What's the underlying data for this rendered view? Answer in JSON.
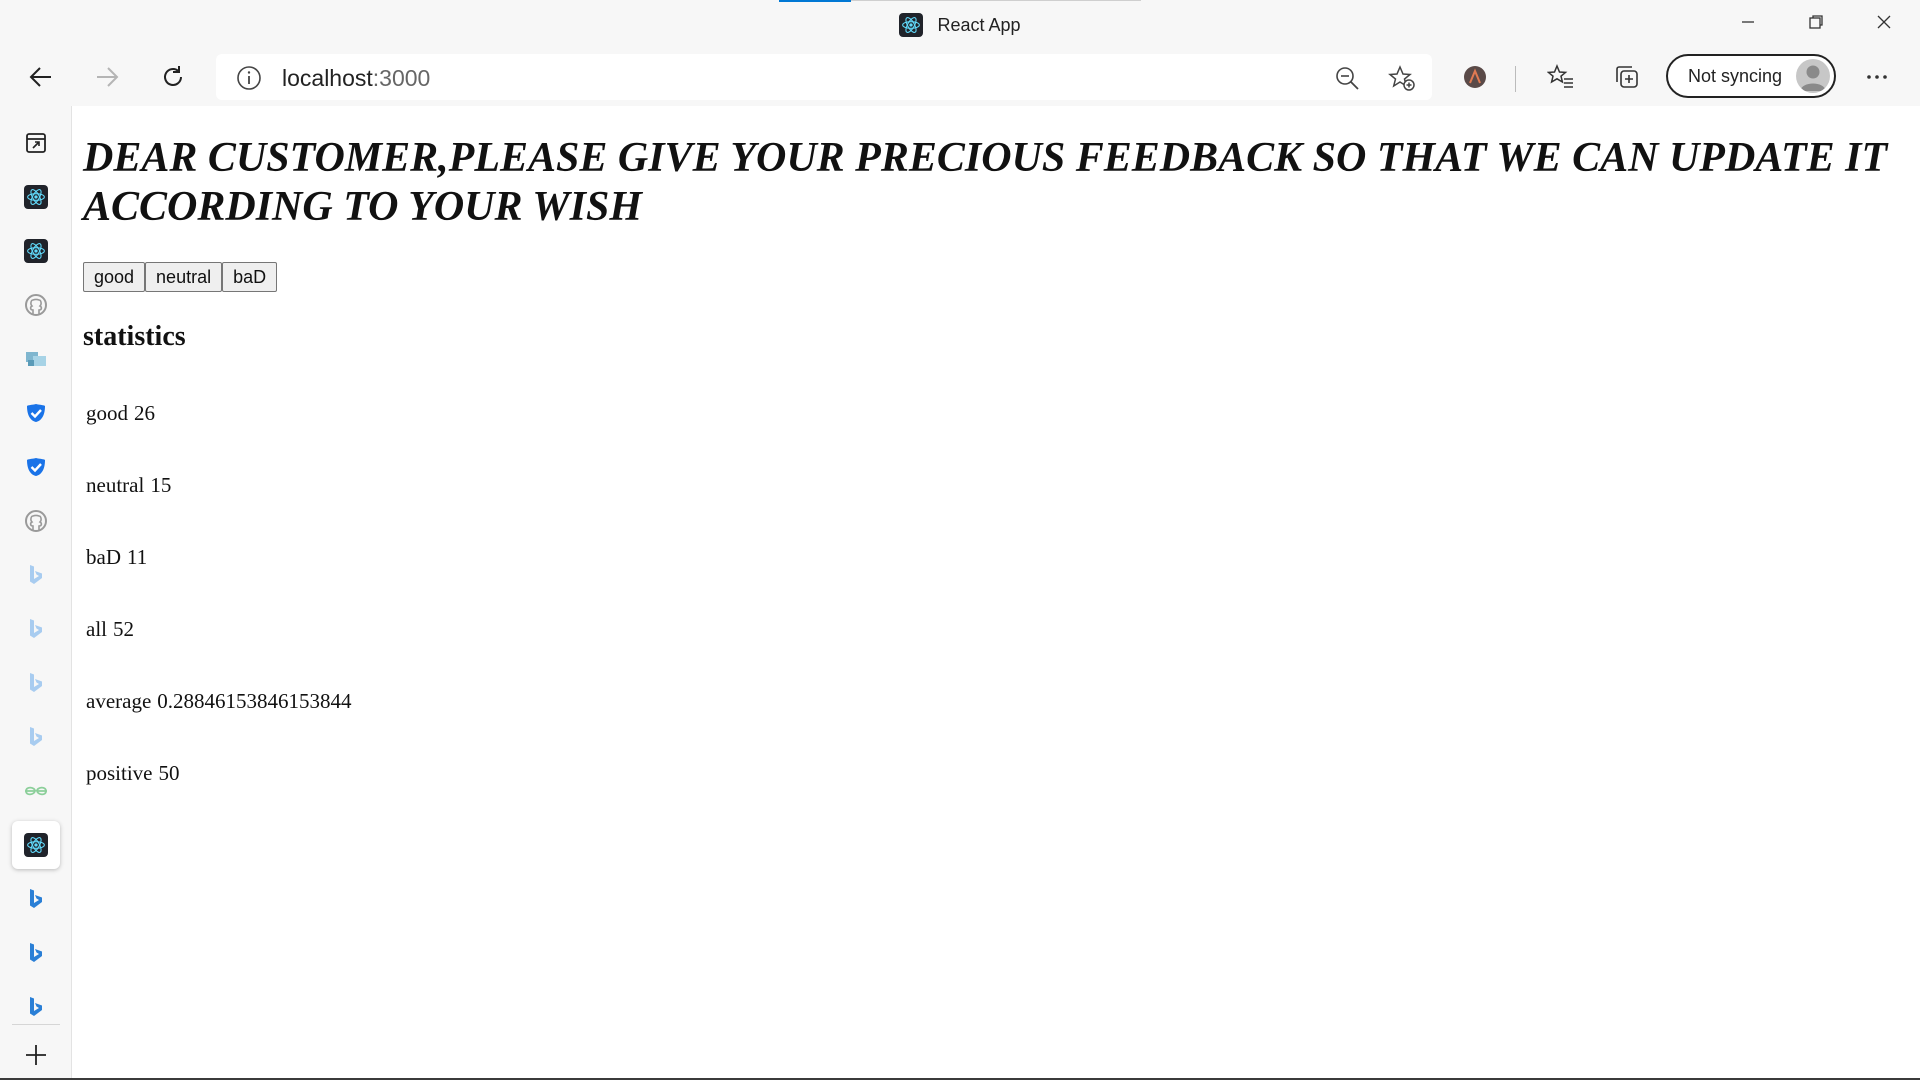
{
  "window": {
    "title": "React App"
  },
  "toolbar": {
    "url_host": "localhost",
    "url_port": ":3000",
    "profile_label": "Not syncing"
  },
  "page": {
    "heading": "DEAR CUSTOMER,PLEASE GIVE YOUR PRECIOUS FEEDBACK SO THAT WE CAN UPDATE IT ACCORDING TO YOUR WISH",
    "buttons": {
      "good": "good",
      "neutral": "neutral",
      "bad": "baD"
    },
    "stats_heading": "statistics",
    "stats": [
      {
        "label": "good",
        "value": "26"
      },
      {
        "label": "neutral",
        "value": "15"
      },
      {
        "label": "baD",
        "value": "11"
      },
      {
        "label": "all",
        "value": "52"
      },
      {
        "label": "average",
        "value": "0.28846153846153844"
      },
      {
        "label": "positive",
        "value": "50"
      }
    ]
  },
  "sidebar": {
    "items": [
      "tab-actions-icon",
      "react-icon",
      "react-icon",
      "github-icon",
      "image-icon",
      "check-shield-icon",
      "check-shield-icon",
      "github-icon",
      "bing-icon",
      "bing-icon",
      "bing-icon",
      "bing-icon",
      "geeksforgeeks-icon",
      "react-icon",
      "bing-icon",
      "bing-icon",
      "bing-icon",
      "add-icon"
    ]
  },
  "colors": {
    "accent": "#0078d4",
    "react": "#61dafb",
    "bing": "#2a7fd6"
  }
}
